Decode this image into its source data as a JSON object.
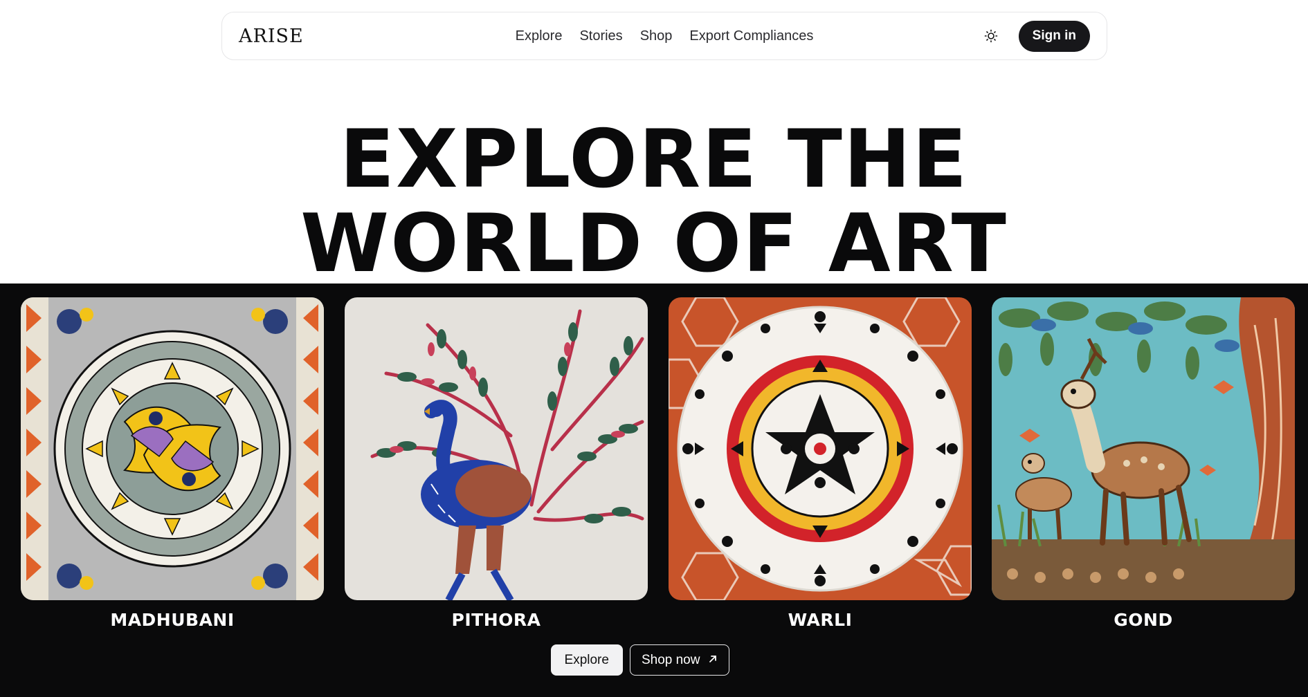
{
  "nav": {
    "logo": "ARISE",
    "links": [
      "Explore",
      "Stories",
      "Shop",
      "Export Compliances"
    ],
    "theme_toggle_icon": "sun-icon",
    "signin_label": "Sign in"
  },
  "hero": {
    "line1": "EXPLORE THE",
    "line2": "WORLD OF ART"
  },
  "gallery": {
    "cards": [
      {
        "label": "MADHUBANI",
        "image": "madhubani-fish-mandala"
      },
      {
        "label": "PITHORA",
        "image": "pithora-peacock-tree"
      },
      {
        "label": "WARLI",
        "image": "warli-circle-dancers"
      },
      {
        "label": "GOND",
        "image": "gond-deer-tree"
      }
    ]
  },
  "actions": {
    "explore_label": "Explore",
    "shop_label": "Shop now",
    "shop_icon": "arrow-up-right-icon"
  },
  "colors": {
    "band_background": "#0a0a0b",
    "primary_button": "#17171a",
    "warli_orange": "#c8542a",
    "gond_sky": "#6cbcc4"
  }
}
